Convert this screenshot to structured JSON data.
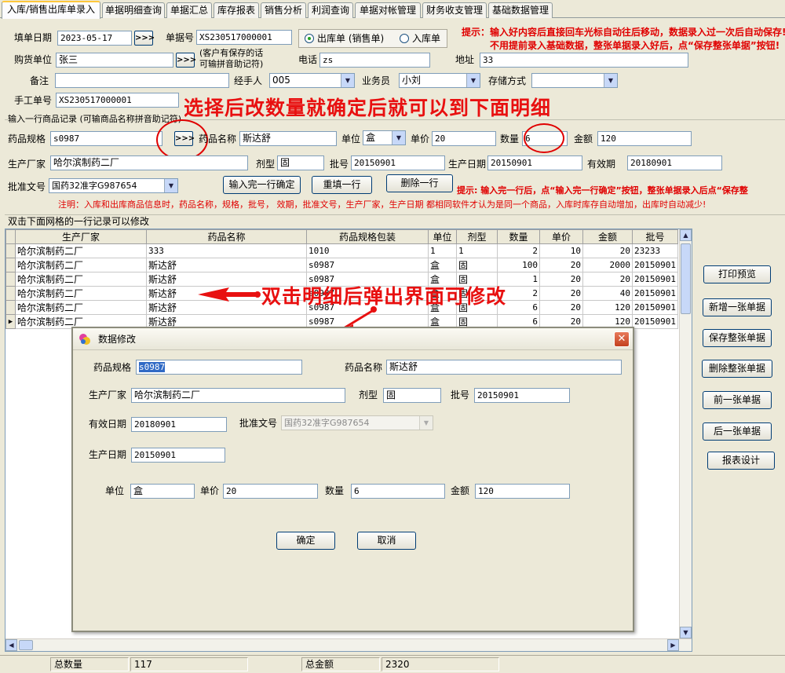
{
  "tabs": [
    "入库/销售出库单录入",
    "单据明细查询",
    "单据汇总",
    "库存报表",
    "销售分析",
    "利润查询",
    "单据对帐管理",
    "财务收支管理",
    "基础数据管理"
  ],
  "header": {
    "date_label": "填单日期",
    "date_value": "2023-05-17",
    "date_btn": ">>>",
    "docno_label": "单据号",
    "docno_value": "XS230517000001",
    "radio_out": "出库单 (销售单)",
    "radio_in": "入库单",
    "tip1": "提示：输入好内容后直接回车光标自动往后移动，数据录入过一次后自动保存!",
    "tip2": "不用提前录入基础数据，整张单据录入好后，点“保存整张单据”按钮!",
    "buyer_label": "购货单位",
    "buyer_value": "张三",
    "buyer_btn": ">>>",
    "buyer_hint1": "(客户有保存的话",
    "buyer_hint2": "可输拼音助记符)",
    "phone_label": "电话",
    "phone_value": "zs",
    "address_label": "地址",
    "address_value": "33",
    "remark_label": "备注",
    "remark_value": "",
    "handler_label": "经手人",
    "handler_value": "005",
    "salesman_label": "业务员",
    "salesman_value": "小刘",
    "storage_label": "存储方式",
    "storage_value": "",
    "manual_label": "手工单号",
    "manual_value": "XS230517000001"
  },
  "callouts": {
    "top": "选择后改数量就确定后就可以到下面明细",
    "middle": "双击明细后弹出界面可修改"
  },
  "item_entry": {
    "group_label": "输入一行商品记录 (可输商品名称拼音助记符)",
    "spec_label": "药品规格",
    "spec_value": "s0987",
    "spec_btn": ">>>",
    "name_label": "药品名称",
    "name_value": "斯达舒",
    "unit_label": "单位",
    "unit_value": "盒",
    "price_label": "单价",
    "price_value": "20",
    "qty_label": "数量",
    "qty_value": "6",
    "amount_label": "金额",
    "amount_value": "120",
    "maker_label": "生产厂家",
    "maker_value": "哈尔滨制药二厂",
    "form_label": "剂型",
    "form_value": "固",
    "batch_label": "批号",
    "batch_value": "20150901",
    "mfg_label": "生产日期",
    "mfg_value": "20150901",
    "exp_label": "有效期",
    "exp_value": "20180901",
    "approval_label": "批准文号",
    "approval_value": "国药32准字G987654",
    "confirm_btn": "输入完一行确定",
    "refill_btn": "重填一行",
    "delete_btn": "删除一行",
    "tip3": "提示: 输入完一行后，点“输入完一行确定”按钮，整张单据录入后点“保存整",
    "note": "注明：入库和出库商品信息时，药品名称，规格，批号，  效期，批准文号，生产厂家，生产日期  都相同软件才认为是同一个商品，入库时库存自动增加，出库时自动减少!"
  },
  "grid": {
    "caption": "双击下面网格的一行记录可以修改",
    "columns": [
      "生产厂家",
      "药品名称",
      "药品规格包装",
      "单位",
      "剂型",
      "数量",
      "单价",
      "金额",
      "批号"
    ],
    "rows": [
      {
        "maker": "哈尔滨制药二厂",
        "name": "333",
        "spec": "1010",
        "unit": "1",
        "form": "1",
        "qty": "2",
        "price": "10",
        "amount": "20",
        "batch": "23233"
      },
      {
        "maker": "哈尔滨制药二厂",
        "name": "斯达舒",
        "spec": "s0987",
        "unit": "盒",
        "form": "固",
        "qty": "100",
        "price": "20",
        "amount": "2000",
        "batch": "20150901"
      },
      {
        "maker": "哈尔滨制药二厂",
        "name": "斯达舒",
        "spec": "s0987",
        "unit": "盒",
        "form": "固",
        "qty": "1",
        "price": "20",
        "amount": "20",
        "batch": "20150901"
      },
      {
        "maker": "哈尔滨制药二厂",
        "name": "斯达舒",
        "spec": "s0987",
        "unit": "盒",
        "form": "固",
        "qty": "2",
        "price": "20",
        "amount": "40",
        "batch": "20150901"
      },
      {
        "maker": "哈尔滨制药二厂",
        "name": "斯达舒",
        "spec": "s0987",
        "unit": "盒",
        "form": "固",
        "qty": "6",
        "price": "20",
        "amount": "120",
        "batch": "20150901"
      },
      {
        "maker": "哈尔滨制药二厂",
        "name": "斯达舒",
        "spec": "s0987",
        "unit": "盒",
        "form": "固",
        "qty": "6",
        "price": "20",
        "amount": "120",
        "batch": "20150901"
      }
    ]
  },
  "side_buttons": [
    "打印预览",
    "新增一张单据",
    "保存整张单据",
    "删除整张单据",
    "前一张单据",
    "后一张单据",
    "报表设计"
  ],
  "dialog": {
    "title": "数据修改",
    "spec_label": "药品规格",
    "spec_value": "s0987",
    "name_label": "药品名称",
    "name_value": "斯达舒",
    "maker_label": "生产厂家",
    "maker_value": "哈尔滨制药二厂",
    "form_label": "剂型",
    "form_value": "固",
    "batch_label": "批号",
    "batch_value": "20150901",
    "exp_label": "有效日期",
    "exp_value": "20180901",
    "approval_label": "批准文号",
    "approval_value": "国药32准字G987654",
    "mfg_label": "生产日期",
    "mfg_value": "20150901",
    "unit_label": "单位",
    "unit_value": "盒",
    "price_label": "单价",
    "price_value": "20",
    "qty_label": "数量",
    "qty_value": "6",
    "amount_label": "金额",
    "amount_value": "120",
    "ok_btn": "确定",
    "cancel_btn": "取消"
  },
  "status": {
    "total_qty_label": "总数量",
    "total_qty_value": "117",
    "total_amount_label": "总金额",
    "total_amount_value": "2320"
  },
  "colors": {
    "accent_red": "#e00000",
    "tab_highlight": "#ffc83c",
    "selection": "#316ac5"
  }
}
